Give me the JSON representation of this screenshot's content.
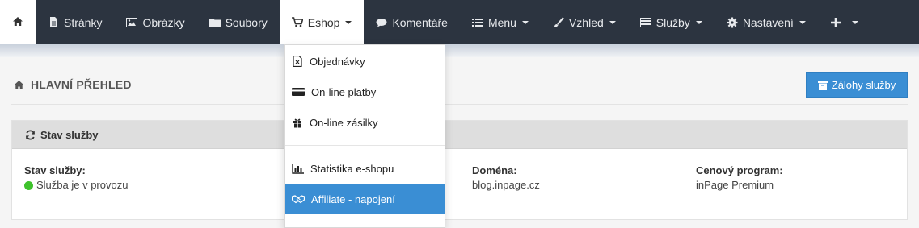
{
  "nav": {
    "home_icon": "home-icon",
    "items": [
      {
        "label": "Stránky",
        "icon": "file-icon"
      },
      {
        "label": "Obrázky",
        "icon": "image-icon"
      },
      {
        "label": "Soubory",
        "icon": "folder-icon"
      },
      {
        "label": "Eshop",
        "icon": "cart-icon",
        "dropdown": true,
        "active": true
      },
      {
        "label": "Komentáře",
        "icon": "comments-icon"
      },
      {
        "label": "Menu",
        "icon": "list-icon",
        "dropdown": true
      },
      {
        "label": "Vzhled",
        "icon": "brush-icon",
        "dropdown": true
      },
      {
        "label": "Služby",
        "icon": "server-icon",
        "dropdown": true
      },
      {
        "label": "Nastavení",
        "icon": "gear-icon",
        "dropdown": true
      },
      {
        "label": "",
        "icon": "plus-icon",
        "dropdown": true
      }
    ]
  },
  "page": {
    "title": "HLAVNÍ PŘEHLED",
    "backup_button": "Zálohy služby"
  },
  "service_panel": {
    "heading": "Stav služby",
    "status_label": "Stav služby:",
    "status_value": "Služba je v provozu",
    "status_color": "#3ec22c",
    "domain_label": "Doména:",
    "domain_value": "blog.inpage.cz",
    "plan_label": "Cenový program:",
    "plan_value": "inPage Premium"
  },
  "eshop_menu": {
    "items": [
      {
        "label": "Objednávky",
        "icon": "invoice-icon"
      },
      {
        "label": "On-line platby",
        "icon": "credit-card-icon"
      },
      {
        "label": "On-line zásilky",
        "icon": "gift-icon"
      },
      {
        "label": "Statistika e-shopu",
        "icon": "bar-chart-icon"
      },
      {
        "label": "Affiliate - napojení",
        "icon": "handshake-icon",
        "active": true
      }
    ]
  },
  "colors": {
    "nav_bg": "#2c3440",
    "accent": "#3a8ed4"
  }
}
